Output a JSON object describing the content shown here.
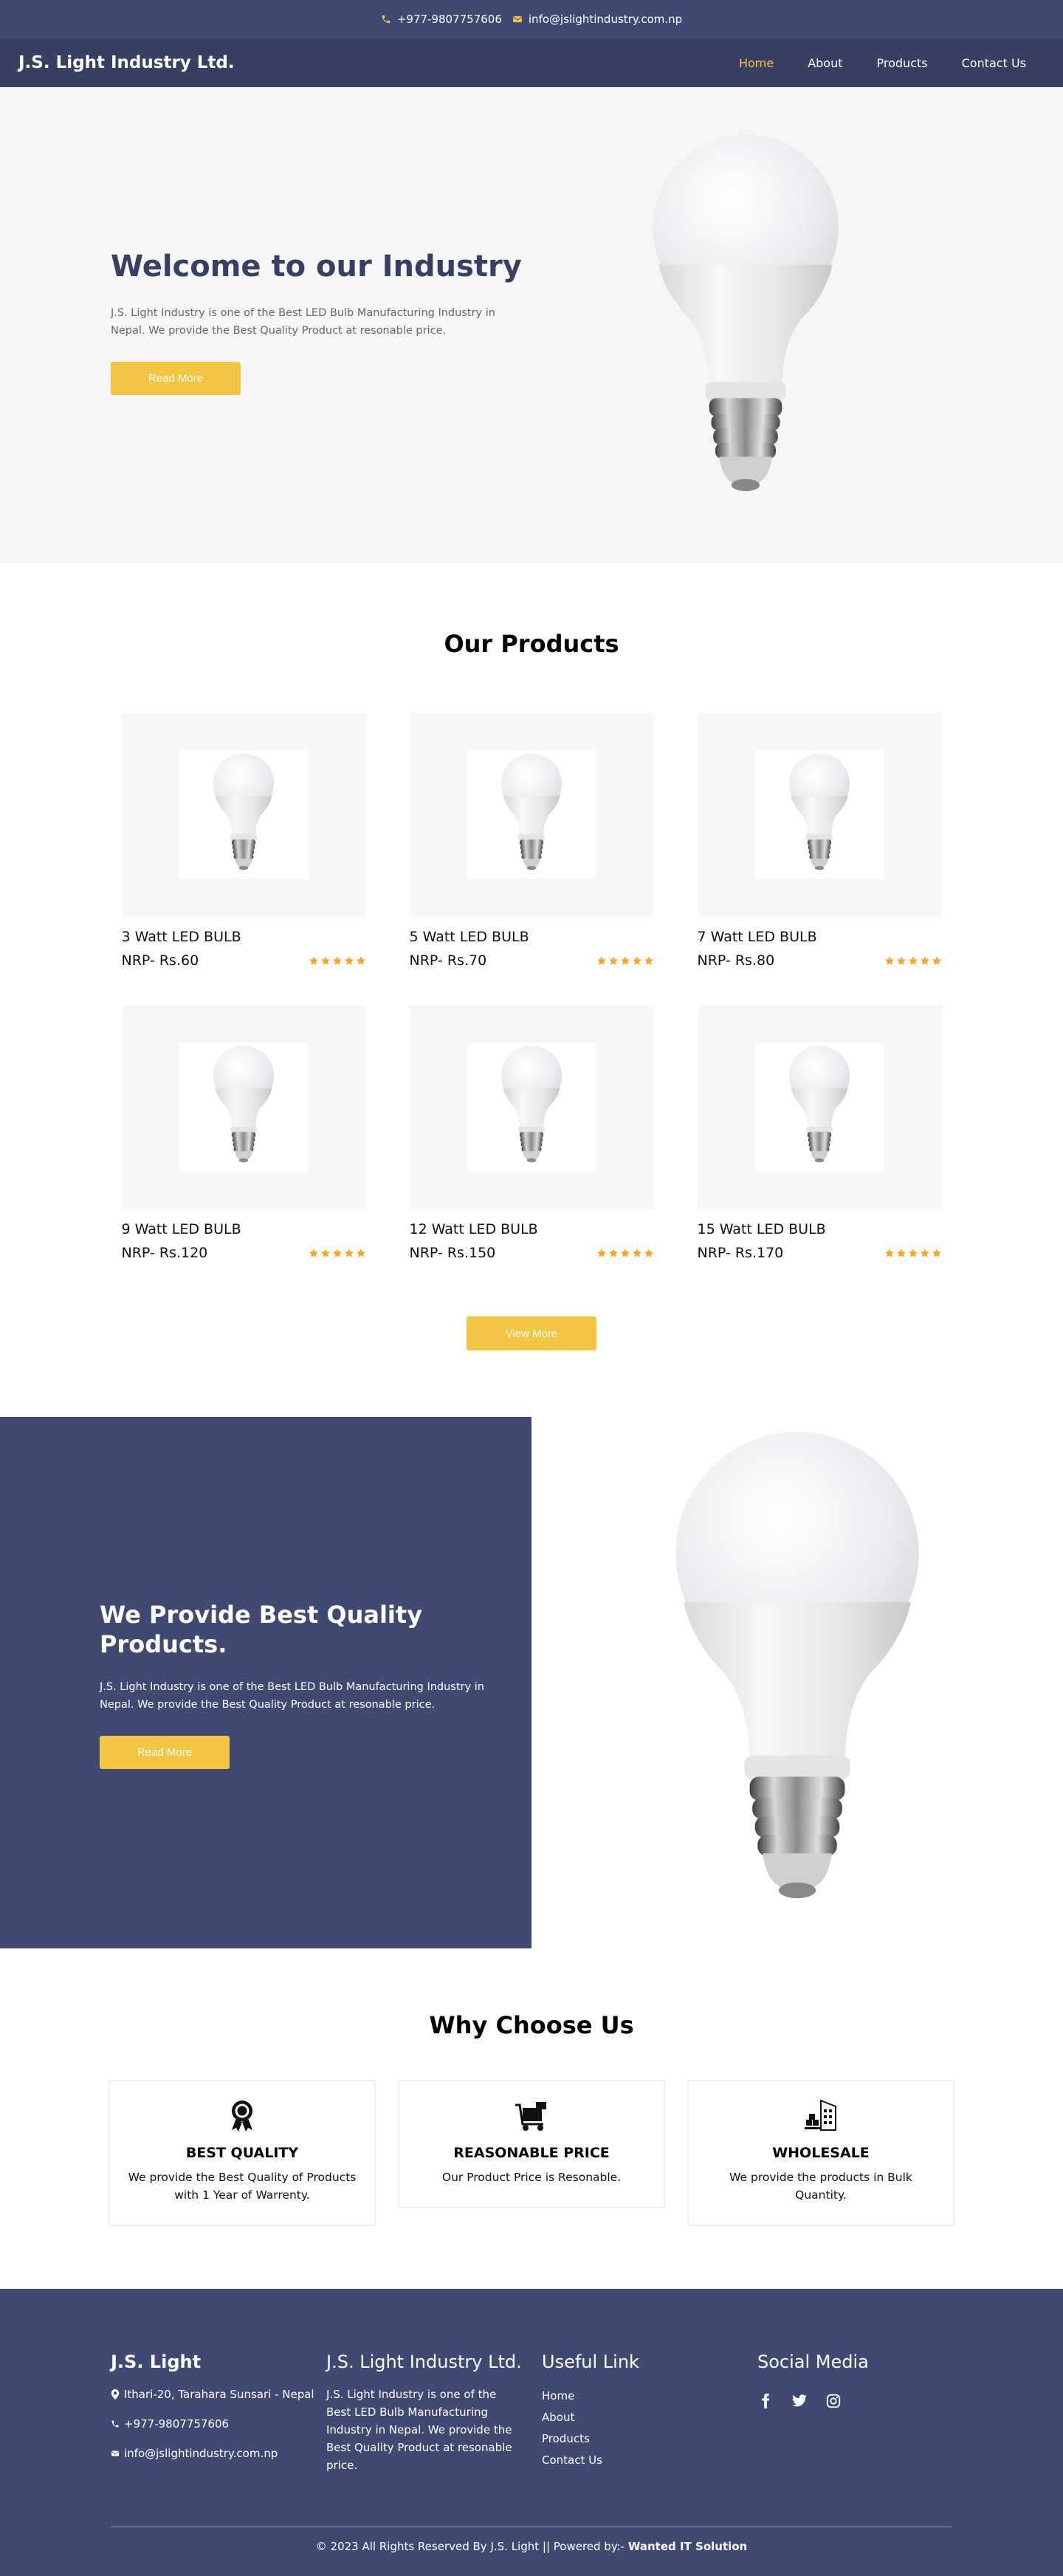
{
  "topbar": {
    "phone": "+977-9807757606",
    "email": "info@jslightindustry.com.np"
  },
  "nav": {
    "brand": "J.S. Light Industry Ltd.",
    "items": [
      {
        "label": "Home",
        "active": true
      },
      {
        "label": "About"
      },
      {
        "label": "Products"
      },
      {
        "label": "Contact Us"
      }
    ]
  },
  "hero": {
    "title": "Welcome to our Industry",
    "description": "J.S. Light Industry is one of the Best LED Bulb Manufacturing Industry in Nepal. We provide the Best Quality Product at resonable price.",
    "button": "Read More"
  },
  "products": {
    "title": "Our Products",
    "items": [
      {
        "name": "3 Watt LED BULB",
        "price": "NRP- Rs.60",
        "rating": 5
      },
      {
        "name": "5 Watt LED BULB",
        "price": "NRP- Rs.70",
        "rating": 5
      },
      {
        "name": "7 Watt LED BULB",
        "price": "NRP- Rs.80",
        "rating": 5
      },
      {
        "name": "9 Watt LED BULB",
        "price": "NRP- Rs.120",
        "rating": 5
      },
      {
        "name": "12 Watt LED BULB",
        "price": "NRP- Rs.150",
        "rating": 5
      },
      {
        "name": "15 Watt LED BULB",
        "price": "NRP- Rs.170",
        "rating": 5
      }
    ],
    "view_more": "View More"
  },
  "quality": {
    "title": "We Provide Best Quality Products.",
    "description": "J.S. Light Industry is one of the Best LED Bulb Manufacturing Industry in Nepal. We provide the Best Quality Product at resonable price.",
    "button": "Read More"
  },
  "why": {
    "title": "Why Choose Us",
    "cards": [
      {
        "icon": "award-badge-icon",
        "title": "BEST QUALITY",
        "text": "We provide the Best Quality of Products with 1 Year of Warrenty."
      },
      {
        "icon": "cart-icon",
        "title": "REASONABLE PRICE",
        "text": "Our Product Price is Resonable."
      },
      {
        "icon": "warehouse-icon",
        "title": "WHOLESALE",
        "text": "We provide the products in Bulk Quantity."
      }
    ]
  },
  "footer": {
    "col1": {
      "title": "J.S. Light",
      "address": "Ithari-20, Tarahara Sunsari - Nepal",
      "phone": "+977-9807757606",
      "email": "info@jslightindustry.com.np"
    },
    "col2": {
      "title": "J.S. Light Industry Ltd.",
      "text": "J.S. Light Industry is one of the Best LED Bulb Manufacturing Industry in Nepal. We provide the Best Quality Product at resonable price."
    },
    "col3": {
      "title": "Useful Link",
      "links": [
        "Home",
        "About",
        "Products",
        "Contact Us"
      ]
    },
    "col4": {
      "title": "Social Media",
      "icons": [
        "facebook-icon",
        "twitter-icon",
        "instagram-icon"
      ]
    },
    "copyright": "© 2023 All Rights Reserved By J.S. Light || Powered by:- ",
    "powered_by": "Wanted IT Solution"
  },
  "colors": {
    "navy": "#3f4a72",
    "navy_dark": "#374063",
    "accent": "#f4c542",
    "star": "#f5a623",
    "light_bg": "#f6f6f6"
  }
}
